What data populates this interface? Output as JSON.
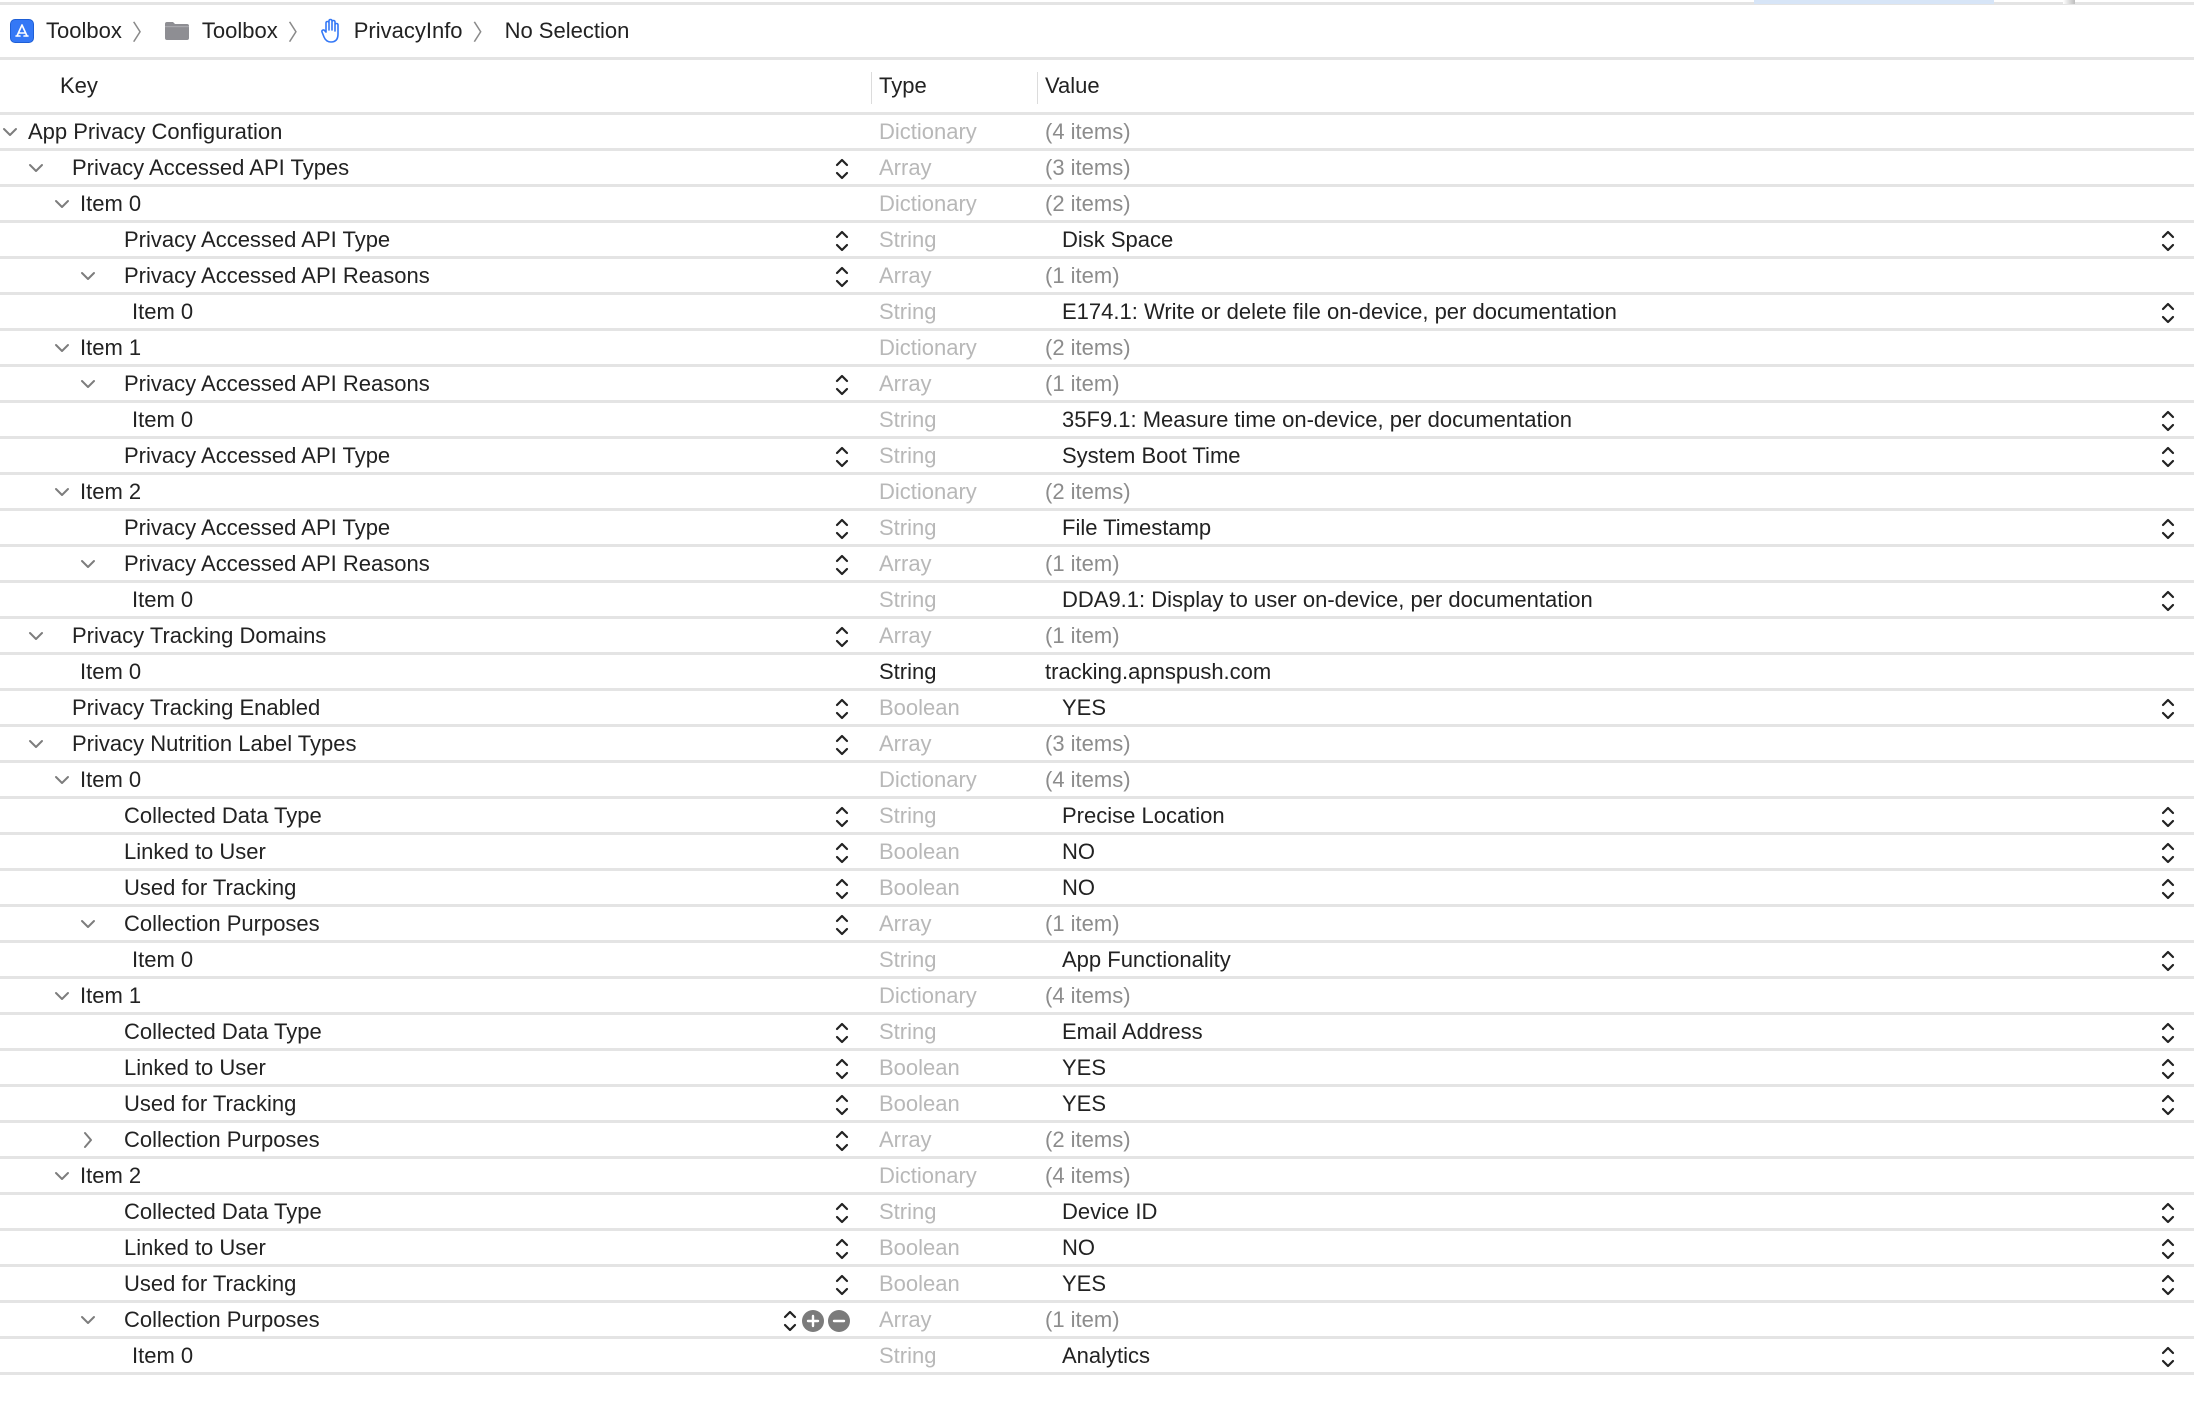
{
  "breadcrumb": {
    "items": [
      {
        "label": "Toolbox",
        "icon": "app-store-icon"
      },
      {
        "label": "Toolbox",
        "icon": "folder-icon"
      },
      {
        "label": "PrivacyInfo",
        "icon": "hand-raised-icon"
      },
      {
        "label": "No Selection",
        "icon": null
      }
    ],
    "separator": "〉"
  },
  "columns": {
    "key": "Key",
    "type": "Type",
    "value": "Value"
  },
  "colors": {
    "accent": "#3478f6",
    "divider": "#e4e4e4",
    "muted_text": "#b8b8b8",
    "primary_text": "#222222"
  },
  "rows": [
    {
      "key": "App Privacy Configuration",
      "level": 0,
      "expand": "open",
      "type": "Dictionary",
      "value": "(4 items)",
      "key_stepper": false,
      "value_kind": "count"
    },
    {
      "key": "Privacy Accessed API Types",
      "level": 1,
      "expand": "open",
      "type": "Array",
      "value": "(3 items)",
      "key_stepper": true,
      "value_kind": "count"
    },
    {
      "key": "Item 0",
      "level": 2,
      "expand": "open",
      "type": "Dictionary",
      "value": "(2 items)",
      "key_stepper": false,
      "value_kind": "count"
    },
    {
      "key": "Privacy Accessed API Type",
      "level": 3,
      "expand": "none",
      "type": "String",
      "value": "Disk Space",
      "key_stepper": true,
      "value_kind": "popup"
    },
    {
      "key": "Privacy Accessed API Reasons",
      "level": 3,
      "expand": "open",
      "type": "Array",
      "value": "(1 item)",
      "key_stepper": true,
      "value_kind": "count"
    },
    {
      "key": "Item 0",
      "level": 4,
      "expand": "none",
      "type": "String",
      "value": "E174.1: Write or delete file on-device, per documentation",
      "key_stepper": false,
      "value_kind": "popup"
    },
    {
      "key": "Item 1",
      "level": 2,
      "expand": "open",
      "type": "Dictionary",
      "value": "(2 items)",
      "key_stepper": false,
      "value_kind": "count"
    },
    {
      "key": "Privacy Accessed API Reasons",
      "level": 3,
      "expand": "open",
      "type": "Array",
      "value": "(1 item)",
      "key_stepper": true,
      "value_kind": "count"
    },
    {
      "key": "Item 0",
      "level": 4,
      "expand": "none",
      "type": "String",
      "value": "35F9.1: Measure time on-device, per documentation",
      "key_stepper": false,
      "value_kind": "popup"
    },
    {
      "key": "Privacy Accessed API Type",
      "level": 3,
      "expand": "none",
      "type": "String",
      "value": "System Boot Time",
      "key_stepper": true,
      "value_kind": "popup"
    },
    {
      "key": "Item 2",
      "level": 2,
      "expand": "open",
      "type": "Dictionary",
      "value": "(2 items)",
      "key_stepper": false,
      "value_kind": "count"
    },
    {
      "key": "Privacy Accessed API Type",
      "level": 3,
      "expand": "none",
      "type": "String",
      "value": "File Timestamp",
      "key_stepper": true,
      "value_kind": "popup"
    },
    {
      "key": "Privacy Accessed API Reasons",
      "level": 3,
      "expand": "open",
      "type": "Array",
      "value": "(1 item)",
      "key_stepper": true,
      "value_kind": "count"
    },
    {
      "key": "Item 0",
      "level": 4,
      "expand": "none",
      "type": "String",
      "value": "DDA9.1: Display to user on-device, per documentation",
      "key_stepper": false,
      "value_kind": "popup"
    },
    {
      "key": "Privacy Tracking Domains",
      "level": 1,
      "expand": "open",
      "type": "Array",
      "value": "(1 item)",
      "key_stepper": true,
      "value_kind": "count"
    },
    {
      "key": "Item 0",
      "level": 2,
      "expand": "none",
      "type": "String",
      "value": "tracking.apnspush.com",
      "key_stepper": false,
      "value_kind": "text"
    },
    {
      "key": "Privacy Tracking Enabled",
      "level": 1,
      "expand": "none",
      "type": "Boolean",
      "value": "YES",
      "key_stepper": true,
      "value_kind": "popup"
    },
    {
      "key": "Privacy Nutrition Label Types",
      "level": 1,
      "expand": "open",
      "type": "Array",
      "value": "(3 items)",
      "key_stepper": true,
      "value_kind": "count"
    },
    {
      "key": "Item 0",
      "level": 2,
      "expand": "open",
      "type": "Dictionary",
      "value": "(4 items)",
      "key_stepper": false,
      "value_kind": "count"
    },
    {
      "key": "Collected Data Type",
      "level": 3,
      "expand": "none",
      "type": "String",
      "value": "Precise Location",
      "key_stepper": true,
      "value_kind": "popup"
    },
    {
      "key": "Linked to User",
      "level": 3,
      "expand": "none",
      "type": "Boolean",
      "value": "NO",
      "key_stepper": true,
      "value_kind": "popup"
    },
    {
      "key": "Used for Tracking",
      "level": 3,
      "expand": "none",
      "type": "Boolean",
      "value": "NO",
      "key_stepper": true,
      "value_kind": "popup"
    },
    {
      "key": "Collection Purposes",
      "level": 3,
      "expand": "open",
      "type": "Array",
      "value": "(1 item)",
      "key_stepper": true,
      "value_kind": "count"
    },
    {
      "key": "Item 0",
      "level": 4,
      "expand": "none",
      "type": "String",
      "value": "App Functionality",
      "key_stepper": false,
      "value_kind": "popup"
    },
    {
      "key": "Item 1",
      "level": 2,
      "expand": "open",
      "type": "Dictionary",
      "value": "(4 items)",
      "key_stepper": false,
      "value_kind": "count"
    },
    {
      "key": "Collected Data Type",
      "level": 3,
      "expand": "none",
      "type": "String",
      "value": "Email Address",
      "key_stepper": true,
      "value_kind": "popup"
    },
    {
      "key": "Linked to User",
      "level": 3,
      "expand": "none",
      "type": "Boolean",
      "value": "YES",
      "key_stepper": true,
      "value_kind": "popup"
    },
    {
      "key": "Used for Tracking",
      "level": 3,
      "expand": "none",
      "type": "Boolean",
      "value": "YES",
      "key_stepper": true,
      "value_kind": "popup"
    },
    {
      "key": "Collection Purposes",
      "level": 3,
      "expand": "closed",
      "type": "Array",
      "value": "(2 items)",
      "key_stepper": true,
      "value_kind": "count"
    },
    {
      "key": "Item 2",
      "level": 2,
      "expand": "open",
      "type": "Dictionary",
      "value": "(4 items)",
      "key_stepper": false,
      "value_kind": "count"
    },
    {
      "key": "Collected Data Type",
      "level": 3,
      "expand": "none",
      "type": "String",
      "value": "Device ID",
      "key_stepper": true,
      "value_kind": "popup"
    },
    {
      "key": "Linked to User",
      "level": 3,
      "expand": "none",
      "type": "Boolean",
      "value": "NO",
      "key_stepper": true,
      "value_kind": "popup"
    },
    {
      "key": "Used for Tracking",
      "level": 3,
      "expand": "none",
      "type": "Boolean",
      "value": "YES",
      "key_stepper": true,
      "value_kind": "popup"
    },
    {
      "key": "Collection Purposes",
      "level": 3,
      "expand": "open",
      "type": "Array",
      "value": "(1 item)",
      "key_stepper": true,
      "value_kind": "count",
      "hover_controls": true
    },
    {
      "key": "Item 0",
      "level": 4,
      "expand": "none",
      "type": "String",
      "value": "Analytics",
      "key_stepper": false,
      "value_kind": "popup"
    }
  ]
}
